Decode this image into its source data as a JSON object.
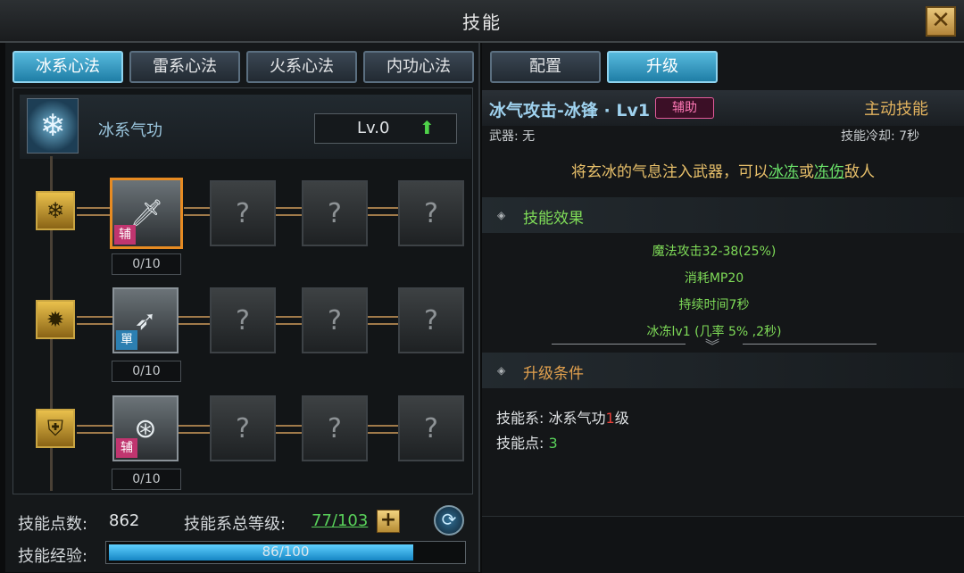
{
  "window": {
    "title": "技能",
    "close_label": "✕"
  },
  "left_tabs": [
    "冰系心法",
    "雷系心法",
    "火系心法",
    "内功心法"
  ],
  "tree": {
    "name": "冰系气功",
    "level": "Lv.0",
    "rows": [
      {
        "icon": "snowflake-icon",
        "skill_badge": "辅",
        "count": "0/10"
      },
      {
        "icon": "flame-icon",
        "skill_badge": "單",
        "count": "0/10"
      },
      {
        "icon": "shield-icon",
        "skill_badge": "辅",
        "count": "0/10"
      }
    ]
  },
  "footer": {
    "points_label": "技能点数:",
    "points_value": "862",
    "total_level_label": "技能系总等级:",
    "total_level_value": "77/103",
    "xp_label": "技能经验:",
    "xp_text": "86/100",
    "xp_progress": 0.86
  },
  "right_tabs": [
    "配置",
    "升级"
  ],
  "skill": {
    "name": "冰气攻击-冰锋 · Lv1",
    "tag": "辅助",
    "type": "主动技能",
    "weapon": "武器: 无",
    "cooldown": "技能冷却: 7秒",
    "desc_prefix": "将玄冰的气息注入武器，可以",
    "desc_link1": "冰冻",
    "desc_mid": "或",
    "desc_link2": "冻伤",
    "desc_suffix": "敌人"
  },
  "effects": {
    "title": "技能效果",
    "lines": [
      "魔法攻击32-38(25%)",
      "消耗MP20",
      "持续时间7秒",
      "冰冻lv1 (几率 5% ,2秒)"
    ]
  },
  "conditions": {
    "title": "升级条件",
    "tree_label": "技能系:",
    "tree_value": "冰系气功",
    "tree_level": "1",
    "tree_unit": "级",
    "points_label": "技能点:",
    "points_value": "3"
  },
  "colors": {
    "accent": "#57b9dd",
    "gold": "#e1b25e",
    "green": "#59d15a",
    "selected": "#e78b22"
  }
}
